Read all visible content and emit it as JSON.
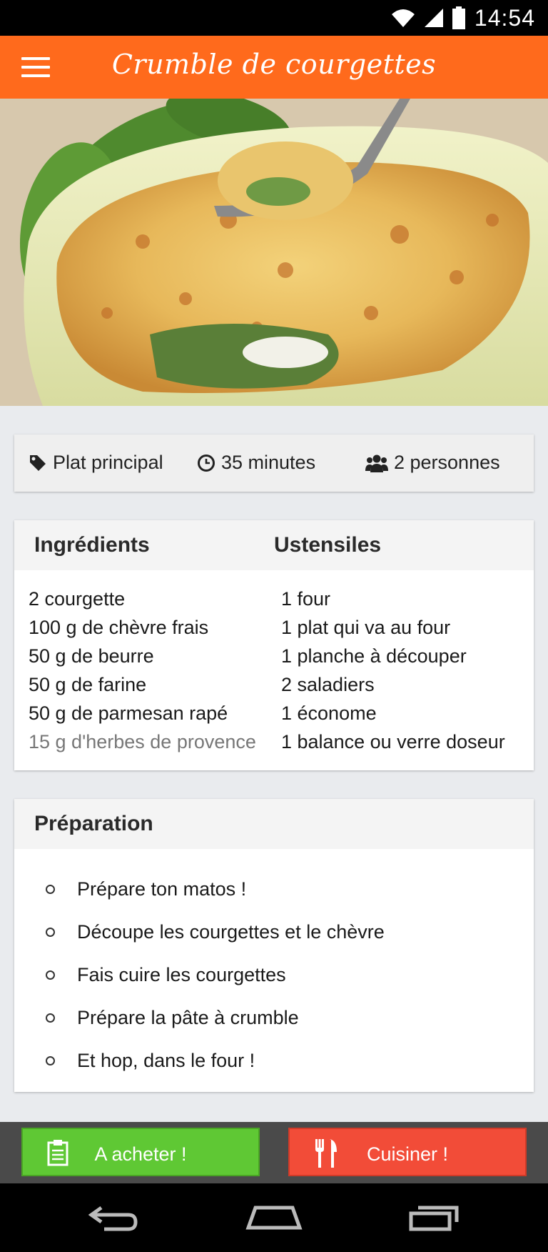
{
  "status_bar": {
    "time": "14:54"
  },
  "app_bar": {
    "title": "Crumble de courgettes"
  },
  "meta": {
    "category": "Plat principal",
    "duration": "35 minutes",
    "servings": "2 personnes"
  },
  "ingredients_card": {
    "ingredients_title": "Ingrédients",
    "utensils_title": "Ustensiles",
    "ingredients": [
      "2 courgette",
      "100 g de chèvre frais",
      "50 g de beurre",
      "50 g de farine",
      "50 g de parmesan rapé",
      "15 g d'herbes de provence"
    ],
    "utensils": [
      "1 four",
      "1 plat qui va au four",
      "1 planche à découper",
      "2 saladiers",
      "1 économe",
      "1 balance ou verre doseur"
    ]
  },
  "preparation": {
    "title": "Préparation",
    "steps": [
      "Prépare ton matos !",
      "Découpe les courgettes et le chèvre",
      "Fais cuire les courgettes",
      "Prépare la pâte à crumble",
      "Et hop, dans le four !"
    ]
  },
  "actions": {
    "buy_label": "A acheter !",
    "cook_label": "Cuisiner !"
  },
  "colors": {
    "accent": "#ff6a1c",
    "buy": "#5fc834",
    "cook": "#f24c38"
  }
}
